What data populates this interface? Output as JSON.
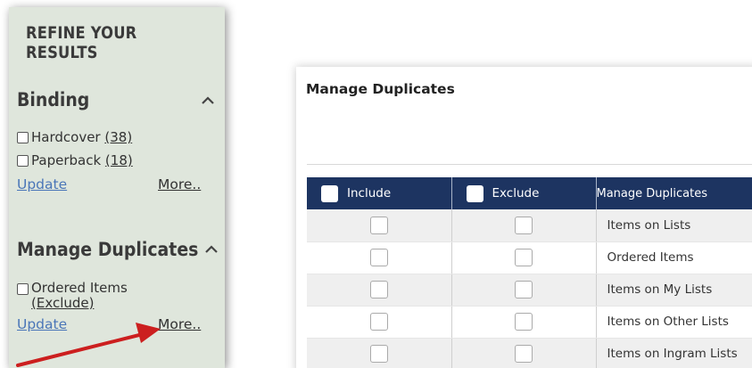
{
  "refine": {
    "title": "REFINE YOUR\nRESULTS",
    "binding": {
      "heading": "Binding",
      "options": [
        {
          "label": "Hardcover",
          "count": "(38)"
        },
        {
          "label": "Paperback",
          "count": "(18)"
        }
      ],
      "update_label": "Update",
      "more_label": "More.."
    },
    "duplicates": {
      "heading": "Manage Duplicates",
      "options": [
        {
          "label": "Ordered Items",
          "sub": "(Exclude)"
        }
      ],
      "update_label": "Update",
      "more_label": "More.."
    }
  },
  "card": {
    "title": "Manage Duplicates",
    "columns": {
      "include": "Include",
      "exclude": "Exclude",
      "manage": "Manage Duplicates"
    },
    "rows": [
      "Items on Lists",
      "Ordered Items",
      "Items on My Lists",
      "Items on Other Lists",
      "Items on Ingram Lists"
    ]
  },
  "colors": {
    "panel_bg": "#dfe6dc",
    "table_header_bg": "#1d3461",
    "link_blue": "#4a76b8",
    "arrow_red": "#cc1f1f"
  },
  "icons": {
    "collapse": "chevron-up-icon",
    "pointer": "red-arrow-annotation"
  }
}
